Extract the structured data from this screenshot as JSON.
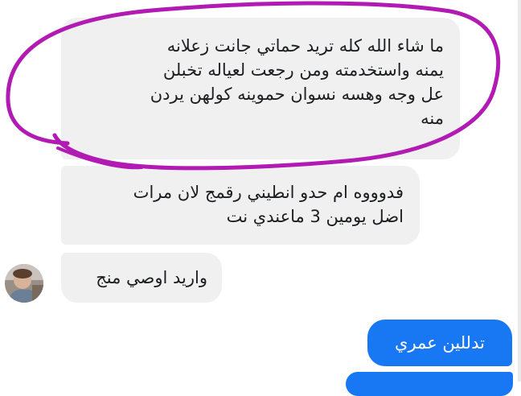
{
  "messages": [
    {
      "direction": "incoming",
      "text": "ما شاء الله كله تريد حماتي جانت زعلانه\nيمنه واستخدمته ومن رجعت لعياله تخبلن\nعل وجه وهسه نسوان حموينه كولهن يردن\nمنه"
    },
    {
      "direction": "incoming",
      "text": "فدوووه ام حدو انطيني رقمج لان مرات\nاضل يومين 3 ماعندي نت"
    },
    {
      "direction": "incoming",
      "text": "واريد اوصي منج"
    },
    {
      "direction": "outgoing",
      "text": "تدللين عمري"
    },
    {
      "direction": "outgoing",
      "text": ""
    }
  ],
  "colors": {
    "incoming_bubble": "#f1f0f0",
    "outgoing_bubble": "#1877f2",
    "annotation_circle": "#b11bb3"
  },
  "icons": {
    "avatar": "sender-avatar-photo"
  }
}
